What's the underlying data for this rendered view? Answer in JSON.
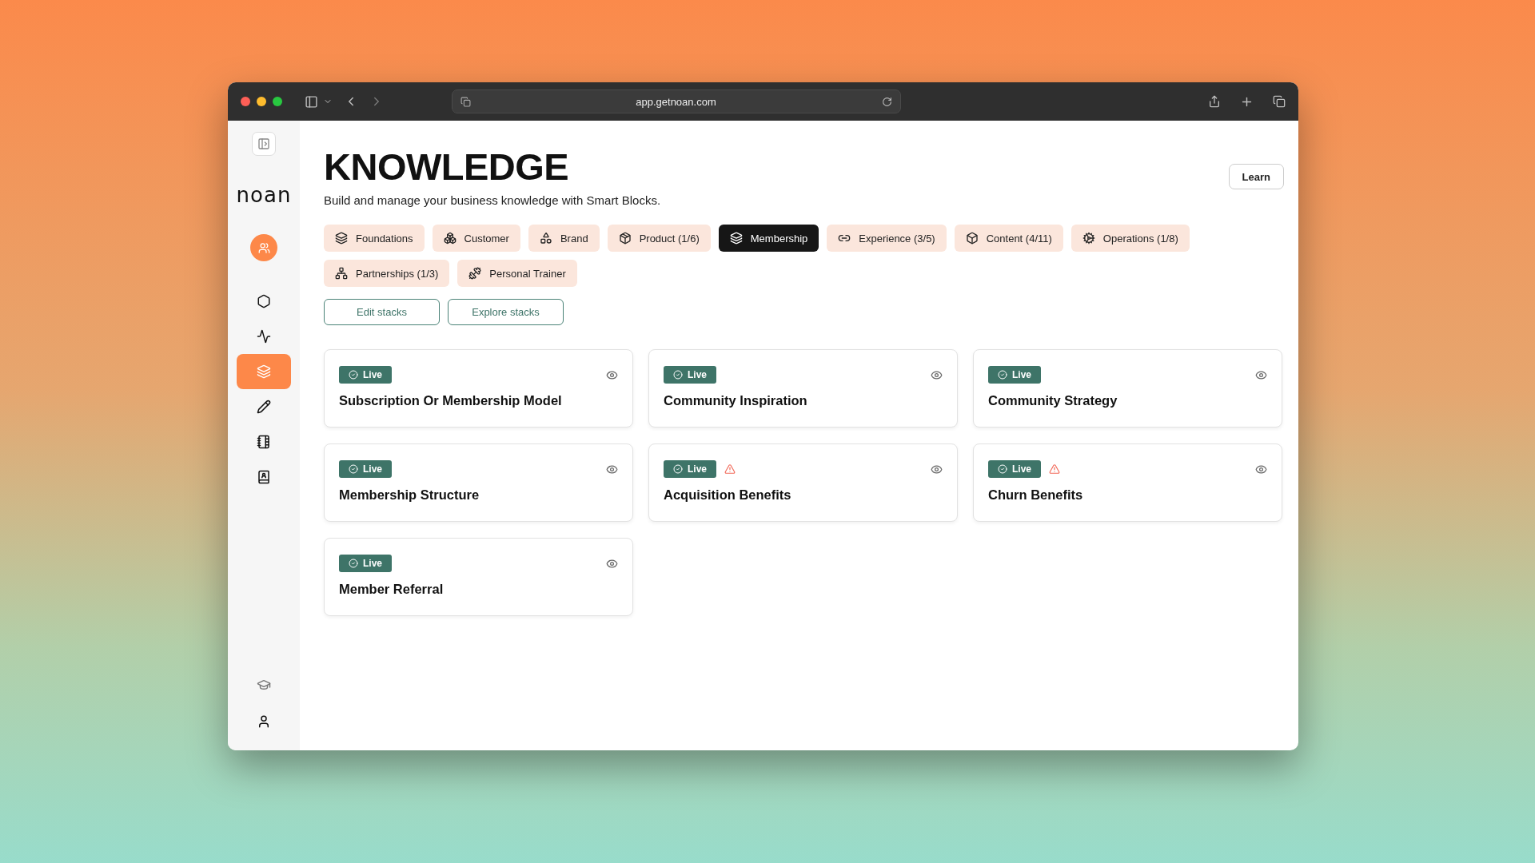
{
  "browser": {
    "url": "app.getnoan.com"
  },
  "sidebar": {
    "logo": "noan",
    "items": [
      {
        "kind": "hexagon",
        "selected": false
      },
      {
        "kind": "activity",
        "selected": false
      },
      {
        "kind": "layers",
        "selected": true
      },
      {
        "kind": "pencil",
        "selected": false
      },
      {
        "kind": "notebook",
        "selected": false
      },
      {
        "kind": "contacts",
        "selected": false
      }
    ],
    "bottom": [
      {
        "kind": "learn"
      },
      {
        "kind": "user"
      }
    ]
  },
  "header": {
    "title": "KNOWLEDGE",
    "subtitle": "Build and manage your business knowledge with Smart Blocks.",
    "action": "Learn"
  },
  "tabs": [
    {
      "label": "Foundations",
      "selected": false
    },
    {
      "label": "Customer",
      "selected": false
    },
    {
      "label": "Brand",
      "selected": false
    },
    {
      "label": "Product (1/6)",
      "selected": false
    },
    {
      "label": "Membership",
      "selected": true
    },
    {
      "label": "Experience (3/5)",
      "selected": false
    },
    {
      "label": "Content (4/11)",
      "selected": false
    },
    {
      "label": "Operations (1/8)",
      "selected": false
    },
    {
      "label": "Partnerships (1/3)",
      "selected": false
    },
    {
      "label": "Personal Trainer",
      "selected": false
    }
  ],
  "stack_buttons": [
    "Edit stacks",
    "Explore stacks"
  ],
  "cards": [
    {
      "status": "Live",
      "title": "Subscription Or Membership Model",
      "warning": false
    },
    {
      "status": "Live",
      "title": "Community Inspiration",
      "warning": false
    },
    {
      "status": "Live",
      "title": "Community Strategy",
      "warning": false
    },
    {
      "status": "Live",
      "title": "Membership Structure",
      "warning": false
    },
    {
      "status": "Live",
      "title": "Acquisition Benefits",
      "warning": true
    },
    {
      "status": "Live",
      "title": "Churn Benefits",
      "warning": true
    },
    {
      "status": "Live",
      "title": "Member Referral",
      "warning": false
    }
  ]
}
